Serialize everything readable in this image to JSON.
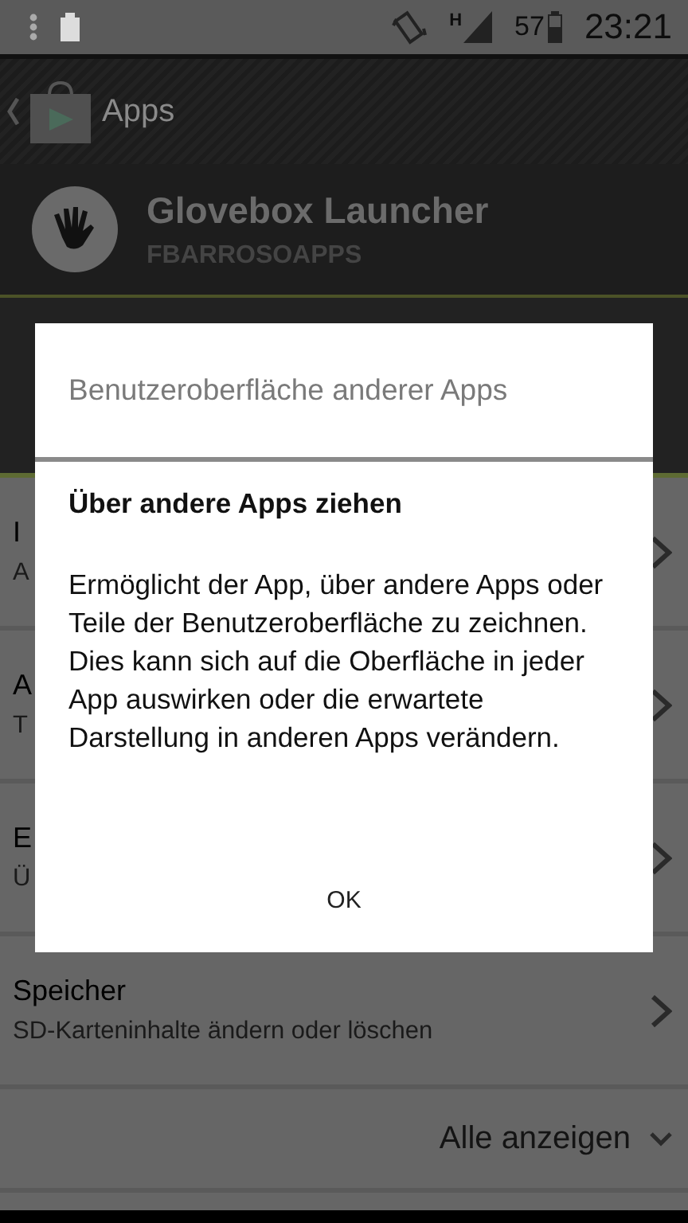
{
  "status_bar": {
    "network": "H",
    "battery": "57",
    "time": "23:21"
  },
  "action_bar": {
    "title": "Apps"
  },
  "app_header": {
    "name": "Glovebox Launcher",
    "developer": "FBARROSOAPPS"
  },
  "permissions": [
    {
      "title": "I",
      "subtitle": "A"
    },
    {
      "title": "A",
      "subtitle": "T"
    },
    {
      "title": "E",
      "subtitle": "Ü"
    },
    {
      "title": "Speicher",
      "subtitle": "SD-Karteninhalte ändern oder löschen"
    }
  ],
  "show_all": {
    "label": "Alle anzeigen"
  },
  "dialog": {
    "title": "Benutzeroberfläche anderer Apps",
    "heading": "Über andere Apps ziehen",
    "message": "Ermöglicht der App, über andere Apps oder Teile der Benutzeroberfläche zu zeichnen. Dies kann sich auf die Oberfläche in jeder App auswirken oder die erwartete Darstellung in anderen Apps verändern.",
    "button": "OK"
  }
}
